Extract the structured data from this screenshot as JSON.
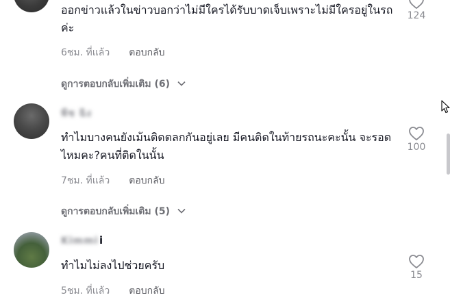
{
  "comments": [
    {
      "text": "ออกข่าวแล้วในข่าวบอกว่าไม่มีใครได้รับบาดเจ็บเพราะไม่มีใครอยู่ในรถค่ะ",
      "time": "6ชม. ที่แล้ว",
      "reply": "ตอบกลับ",
      "likes": "124",
      "more_replies": "ดูการตอบกลับเพิ่มเติม (6)"
    },
    {
      "username": "พีช ฉิง",
      "text": "ทำไมบางคนยังเม้นติดตลกกันอยู่เลย มีคนติดในท้ายรถนะคะนั้น จะรอดไหมคะ?คนที่ติดในนั้น",
      "time": "7ชม. ที่แล้ว",
      "reply": "ตอบกลับ",
      "likes": "100",
      "more_replies": "ดูการตอบกลับเพิ่มเติม (5)"
    },
    {
      "username": "Kimmi",
      "username_suffix": "i",
      "text": "ทำไมไม่ลงไปช่วยครับ",
      "time": "5ชม. ที่แล้ว",
      "reply": "ตอบกลับ",
      "likes": "15"
    }
  ],
  "icons": {
    "like": "heart-outline-icon",
    "expand": "chevron-down-icon",
    "pointer": "mouse-cursor-icon"
  },
  "colors": {
    "text": "#161823",
    "secondary": "#8a8b91"
  }
}
